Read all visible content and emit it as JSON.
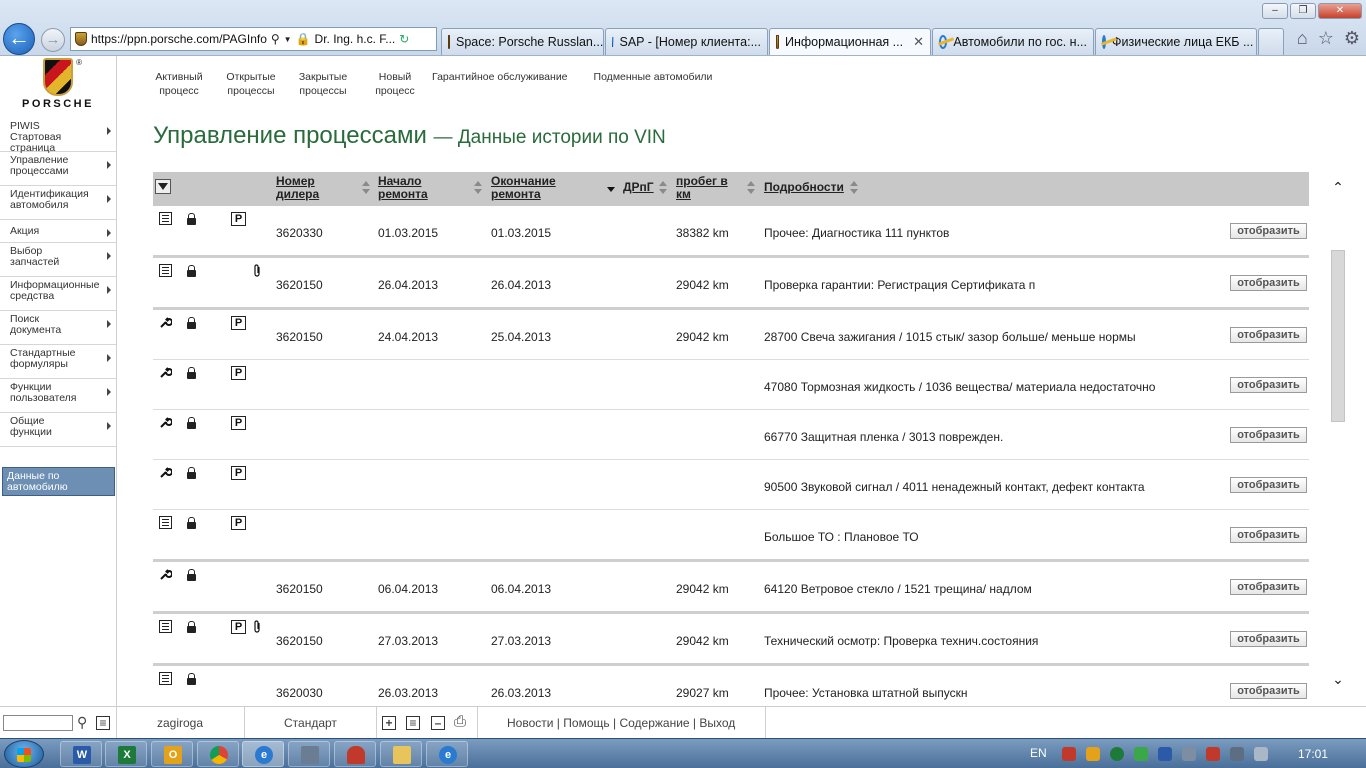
{
  "browser": {
    "address_url": "https://ppn.porsche.com/PAGInfo",
    "address_cert": "Dr. Ing. h.c. F...",
    "tabs": [
      {
        "label": "Space: Porsche Russlan...",
        "icon": "porsche-favicon",
        "active": false
      },
      {
        "label": "SAP - [Номер клиента:...",
        "icon": "sap-favicon",
        "active": false
      },
      {
        "label": "Информационная ...",
        "icon": "porsche-favicon",
        "active": true
      },
      {
        "label": "Автомобили по гос. н...",
        "icon": "ie-favicon",
        "active": false
      },
      {
        "label": "Физические лица ЕКБ ...",
        "icon": "ie-favicon",
        "active": false
      }
    ]
  },
  "sidebar": {
    "logo_text": "PORSCHE",
    "logo_reg": "®",
    "items": [
      {
        "line1": "PIWIS",
        "line2": "Стартовая страница"
      },
      {
        "line1": "Управление",
        "line2": "процессами"
      },
      {
        "line1": "Идентификация",
        "line2": "автомобиля"
      },
      {
        "line1": "Акция",
        "line2": ""
      },
      {
        "line1": "Выбор",
        "line2": "запчастей"
      },
      {
        "line1": "Информационные",
        "line2": "средства"
      },
      {
        "line1": "Поиск",
        "line2": "документа"
      },
      {
        "line1": "Стандартные",
        "line2": "формуляры"
      },
      {
        "line1": "Функции",
        "line2": "пользователя"
      },
      {
        "line1": "Общие",
        "line2": "функции"
      }
    ],
    "active_item": {
      "line1": "Данные по",
      "line2": "автомобилю"
    }
  },
  "topnav": [
    {
      "label": "Активный\nпроцесс"
    },
    {
      "label": "Открытые\nпроцессы"
    },
    {
      "label": "Закрытые\nпроцессы"
    },
    {
      "label": "Новый\nпроцесс"
    },
    {
      "label": "Гарантийное обслуживание"
    },
    {
      "label": "Подменные автомобили"
    }
  ],
  "page": {
    "title": "Управление процессами",
    "subtitle": "Данные истории по VIN"
  },
  "table": {
    "headers": {
      "dealer": "Номер\nдилера",
      "start": "Начало\nремонта",
      "end": "Окончание\nремонта",
      "drpg": "ДРпГ",
      "mileage": "пробег в\nкм",
      "details": "Подробности"
    },
    "show_label": "отобразить",
    "rows": [
      {
        "type": "doc",
        "p": true,
        "clip": false,
        "dealer": "3620330",
        "start": "01.03.2015",
        "end": "01.03.2015",
        "mileage": "38382 km",
        "details": "Прочее:  Диагностика 111 пунктов",
        "thick": true
      },
      {
        "type": "doc",
        "p": false,
        "clip": true,
        "dealer": "3620150",
        "start": "26.04.2013",
        "end": "26.04.2013",
        "mileage": "29042 km",
        "details": "Проверка гарантии:  Регистрация Сертификата п",
        "thick": true
      },
      {
        "type": "wrench",
        "p": true,
        "clip": false,
        "dealer": "3620150",
        "start": "24.04.2013",
        "end": "25.04.2013",
        "mileage": "29042 km",
        "details": "28700 Свеча зажигания / 1015 стык/ зазор больше/ меньше нормы",
        "thick": false
      },
      {
        "type": "wrench",
        "p": true,
        "clip": false,
        "dealer": "",
        "start": "",
        "end": "",
        "mileage": "",
        "details": "47080 Тормозная жидкость / 1036 вещества/ материала недостаточно",
        "thick": false
      },
      {
        "type": "wrench",
        "p": true,
        "clip": false,
        "dealer": "",
        "start": "",
        "end": "",
        "mileage": "",
        "details": "66770 Защитная пленка / 3013 поврежден.",
        "thick": false
      },
      {
        "type": "wrench",
        "p": true,
        "clip": false,
        "dealer": "",
        "start": "",
        "end": "",
        "mileage": "",
        "details": "90500 Звуковой сигнал / 4011 ненадежный контакт, дефект контакта",
        "thick": false
      },
      {
        "type": "doc",
        "p": true,
        "clip": false,
        "dealer": "",
        "start": "",
        "end": "",
        "mileage": "",
        "details": "Большое ТО :  Плановое ТО",
        "thick": true
      },
      {
        "type": "wrench",
        "p": false,
        "clip": false,
        "dealer": "3620150",
        "start": "06.04.2013",
        "end": "06.04.2013",
        "mileage": "29042 km",
        "details": "64120 Ветровое стекло / 1521 трещина/ надлом",
        "thick": true
      },
      {
        "type": "doc",
        "p": true,
        "clip": true,
        "dealer": "3620150",
        "start": "27.03.2013",
        "end": "27.03.2013",
        "mileage": "29042 km",
        "details": "Технический осмотр:  Проверка технич.состояния",
        "thick": true
      },
      {
        "type": "doc",
        "p": false,
        "clip": false,
        "dealer": "3620030",
        "start": "26.03.2013",
        "end": "26.03.2013",
        "mileage": "29027 km",
        "details": "Прочее:  Установка штатной выпускн",
        "thick": false
      }
    ]
  },
  "statusbar": {
    "user": "zagiroga",
    "mode": "Стандарт",
    "news": "Новости",
    "help": "Помощь",
    "contents": "Содержание",
    "logout": "Выход",
    "divider": "|"
  },
  "taskbar": {
    "apps": [
      "W",
      "X",
      "O",
      "C",
      "e",
      "",
      "",
      "",
      "e"
    ],
    "lang": "EN",
    "clock": "17:01"
  }
}
